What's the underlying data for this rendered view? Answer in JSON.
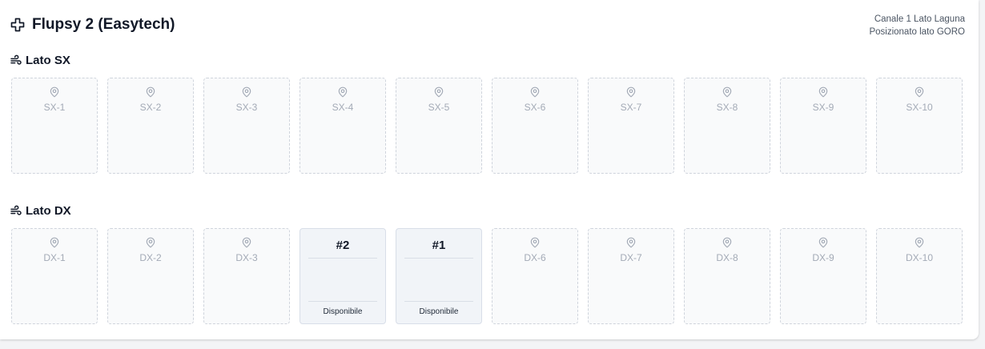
{
  "header": {
    "title": "Flupsy 2 (Easytech)",
    "meta_line1": "Canale 1 Lato Laguna",
    "meta_line2": "Posizionato lato GORO"
  },
  "icons": {
    "title_icon": "move-cross-icon",
    "section_icon": "wind-icon",
    "slot_icon": "map-pin-icon"
  },
  "colors": {
    "empty_slot_border": "#cfd4dc",
    "empty_slot_text": "#a3aab6",
    "occupied_slot_bg": "#f1f4f8"
  },
  "sections": [
    {
      "title": "Lato SX",
      "slots": [
        {
          "label": "SX-1"
        },
        {
          "label": "SX-2"
        },
        {
          "label": "SX-3"
        },
        {
          "label": "SX-4"
        },
        {
          "label": "SX-5"
        },
        {
          "label": "SX-6"
        },
        {
          "label": "SX-7"
        },
        {
          "label": "SX-8"
        },
        {
          "label": "SX-9"
        },
        {
          "label": "SX-10"
        }
      ]
    },
    {
      "title": "Lato DX",
      "slots": [
        {
          "label": "DX-1"
        },
        {
          "label": "DX-2"
        },
        {
          "label": "DX-3"
        },
        {
          "basket": "#2",
          "status": "Disponibile"
        },
        {
          "basket": "#1",
          "status": "Disponibile"
        },
        {
          "label": "DX-6"
        },
        {
          "label": "DX-7"
        },
        {
          "label": "DX-8"
        },
        {
          "label": "DX-9"
        },
        {
          "label": "DX-10"
        }
      ]
    }
  ]
}
